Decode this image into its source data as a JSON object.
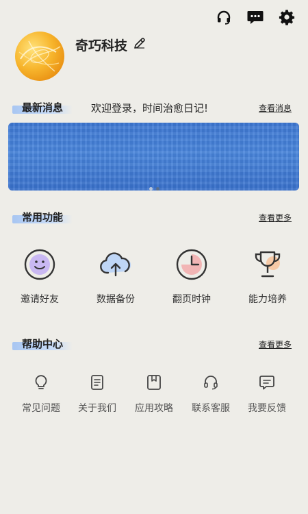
{
  "profile": {
    "username": "奇巧科技"
  },
  "news": {
    "title": "最新消息",
    "message": "欢迎登录，时间治愈日记!",
    "more": "查看消息"
  },
  "common": {
    "title": "常用功能",
    "more": "查看更多",
    "items": [
      {
        "label": "邀请好友",
        "icon": "smiley-icon"
      },
      {
        "label": "数据备份",
        "icon": "cloud-upload-icon"
      },
      {
        "label": "翻页时钟",
        "icon": "clock-icon"
      },
      {
        "label": "能力培养",
        "icon": "trophy-icon"
      }
    ]
  },
  "help": {
    "title": "帮助中心",
    "more": "查看更多",
    "items": [
      {
        "label": "常见问题",
        "icon": "lightbulb-icon"
      },
      {
        "label": "关于我们",
        "icon": "document-icon"
      },
      {
        "label": "应用攻略",
        "icon": "bookmark-icon"
      },
      {
        "label": "联系客服",
        "icon": "headset-icon"
      },
      {
        "label": "我要反馈",
        "icon": "feedback-icon"
      }
    ]
  },
  "colors": {
    "background": "#eeede8",
    "banner": "#4a86db",
    "accent_highlight": "#a8c6f2"
  }
}
